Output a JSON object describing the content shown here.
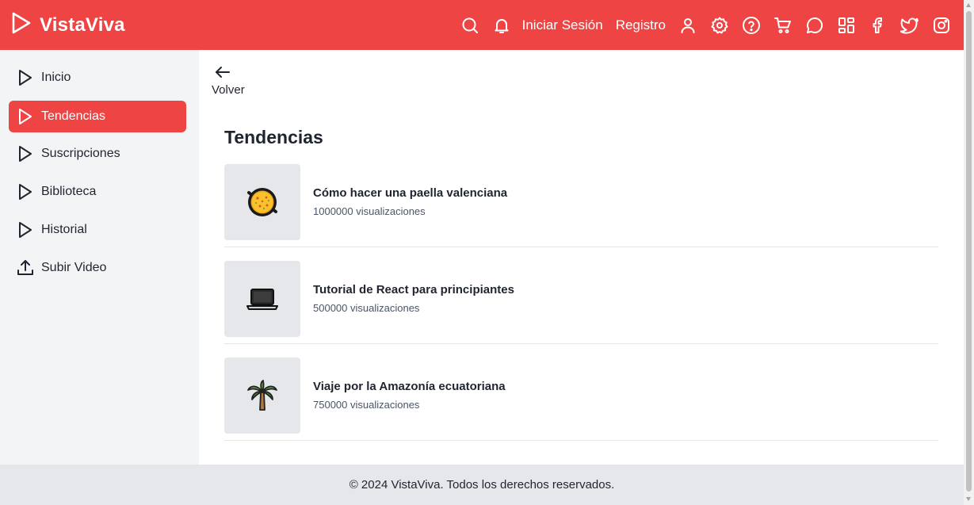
{
  "header": {
    "brand": "VistaViva",
    "login_label": "Iniciar Sesión",
    "register_label": "Registro",
    "icons": [
      "search-icon",
      "bell-icon",
      "user-icon",
      "gear-icon",
      "help-icon",
      "cart-icon",
      "chat-icon",
      "grid-icon",
      "facebook-icon",
      "twitter-icon",
      "instagram-icon"
    ],
    "color": "#ef4444"
  },
  "sidebar": {
    "items": [
      {
        "label": "Inicio",
        "icon": "play-icon"
      },
      {
        "label": "Tendencias",
        "icon": "play-icon",
        "active": true
      },
      {
        "label": "Suscripciones",
        "icon": "play-icon"
      },
      {
        "label": "Biblioteca",
        "icon": "play-icon"
      },
      {
        "label": "Historial",
        "icon": "play-icon"
      },
      {
        "label": "Subir Video",
        "icon": "upload-icon"
      }
    ]
  },
  "main": {
    "back_label": "Volver",
    "title": "Tendencias",
    "videos": [
      {
        "title": "Cómo hacer una paella valenciana",
        "views": "1000000 visualizaciones",
        "thumb": "paella-icon"
      },
      {
        "title": "Tutorial de React para principiantes",
        "views": "500000 visualizaciones",
        "thumb": "laptop-icon"
      },
      {
        "title": "Viaje por la Amazonía ecuatoriana",
        "views": "750000 visualizaciones",
        "thumb": "palm-tree-icon"
      }
    ]
  },
  "footer": {
    "text": "© 2024 VistaViva. Todos los derechos reservados."
  }
}
